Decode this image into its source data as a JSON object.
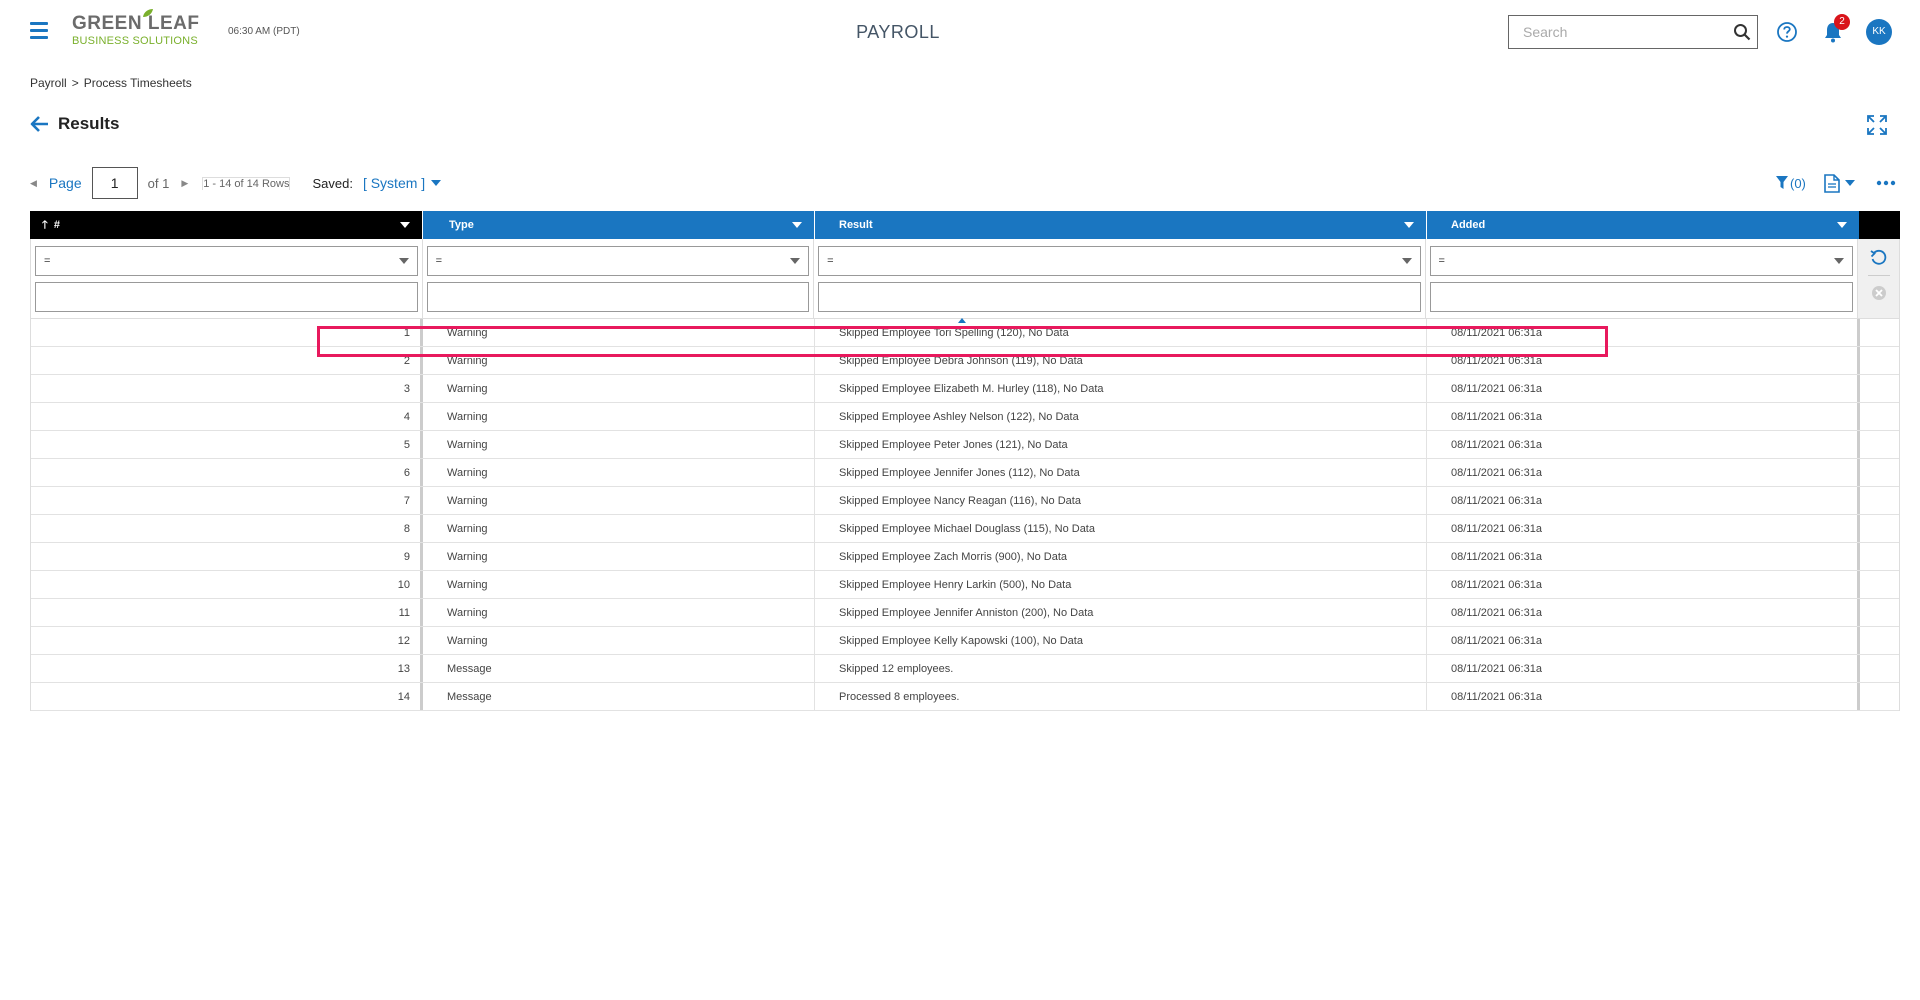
{
  "header": {
    "logo_top": "GREEN LEAF",
    "logo_bottom": "BUSINESS SOLUTIONS",
    "clock": "06:30 AM (PDT)",
    "title": "PAYROLL",
    "search_placeholder": "Search",
    "notification_count": "2",
    "avatar_initials": "KK"
  },
  "breadcrumb": {
    "parent": "Payroll",
    "separator": ">",
    "current": "Process Timesheets"
  },
  "results_title": "Results",
  "pager": {
    "page_label": "Page",
    "page_value": "1",
    "of_text": "of 1",
    "rows_text": "1 - 14 of 14 Rows",
    "saved_label": "Saved:",
    "saved_value": "[ System ]"
  },
  "toolbar": {
    "filter_count": "(0)"
  },
  "columns": {
    "num": "#",
    "type": "Type",
    "result": "Result",
    "added": "Added"
  },
  "filters": {
    "operator": "="
  },
  "rows": [
    {
      "num": "1",
      "type": "Warning",
      "result": "Skipped Employee Tori Spelling (120), No Data",
      "added": "08/11/2021 06:31a"
    },
    {
      "num": "2",
      "type": "Warning",
      "result": "Skipped Employee Debra Johnson (119), No Data",
      "added": "08/11/2021 06:31a"
    },
    {
      "num": "3",
      "type": "Warning",
      "result": "Skipped Employee Elizabeth M. Hurley (118), No Data",
      "added": "08/11/2021 06:31a"
    },
    {
      "num": "4",
      "type": "Warning",
      "result": "Skipped Employee Ashley Nelson (122), No Data",
      "added": "08/11/2021 06:31a"
    },
    {
      "num": "5",
      "type": "Warning",
      "result": "Skipped Employee Peter Jones (121), No Data",
      "added": "08/11/2021 06:31a"
    },
    {
      "num": "6",
      "type": "Warning",
      "result": "Skipped Employee Jennifer Jones (112), No Data",
      "added": "08/11/2021 06:31a"
    },
    {
      "num": "7",
      "type": "Warning",
      "result": "Skipped Employee Nancy Reagan (116), No Data",
      "added": "08/11/2021 06:31a"
    },
    {
      "num": "8",
      "type": "Warning",
      "result": "Skipped Employee Michael Douglass (115), No Data",
      "added": "08/11/2021 06:31a"
    },
    {
      "num": "9",
      "type": "Warning",
      "result": "Skipped Employee Zach Morris (900), No Data",
      "added": "08/11/2021 06:31a"
    },
    {
      "num": "10",
      "type": "Warning",
      "result": "Skipped Employee Henry Larkin (500), No Data",
      "added": "08/11/2021 06:31a"
    },
    {
      "num": "11",
      "type": "Warning",
      "result": "Skipped Employee Jennifer Anniston (200), No Data",
      "added": "08/11/2021 06:31a"
    },
    {
      "num": "12",
      "type": "Warning",
      "result": "Skipped Employee Kelly Kapowski (100), No Data",
      "added": "08/11/2021 06:31a"
    },
    {
      "num": "13",
      "type": "Message",
      "result": "Skipped 12 employees.",
      "added": "08/11/2021 06:31a"
    },
    {
      "num": "14",
      "type": "Message",
      "result": "Processed 8 employees.",
      "added": "08/11/2021 06:31a"
    }
  ],
  "colors": {
    "accent": "#1a76c1",
    "brand_green": "#7ab02c",
    "highlight": "#e8195d",
    "badge": "#d9141b"
  }
}
